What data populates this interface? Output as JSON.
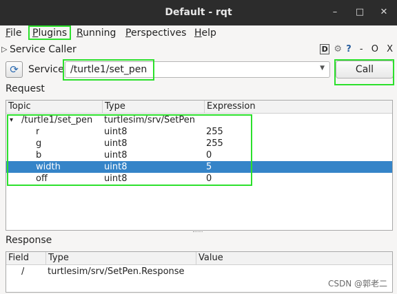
{
  "window": {
    "title": "Default - rqt",
    "controls": [
      "–",
      "□",
      "✕"
    ]
  },
  "menubar": {
    "items": [
      {
        "accel": "F",
        "rest": "ile"
      },
      {
        "accel": "P",
        "rest": "lugins"
      },
      {
        "accel": "R",
        "rest": "unning"
      },
      {
        "accel": "P",
        "rest": "erspectives"
      },
      {
        "accel": "H",
        "rest": "elp"
      }
    ]
  },
  "plugin": {
    "title": "Service Caller",
    "header_icons": [
      "D",
      "⚙",
      "?",
      "-",
      "O",
      "X"
    ]
  },
  "service": {
    "label": "Service",
    "value": "/turtle1/set_pen",
    "call_label": "Call",
    "refresh_icon": "refresh-icon"
  },
  "request": {
    "label": "Request",
    "columns": [
      "Topic",
      "Type",
      "Expression"
    ],
    "rows": [
      {
        "topic": "/turtle1/set_pen",
        "type": "turtlesim/srv/SetPen",
        "expr": "",
        "expander": "▾",
        "selected": false
      },
      {
        "topic": "r",
        "type": "uint8",
        "expr": "255",
        "selected": false
      },
      {
        "topic": "g",
        "type": "uint8",
        "expr": "255",
        "selected": false
      },
      {
        "topic": "b",
        "type": "uint8",
        "expr": "0",
        "selected": false
      },
      {
        "topic": "width",
        "type": "uint8",
        "expr": "5",
        "selected": true
      },
      {
        "topic": "off",
        "type": "uint8",
        "expr": "0",
        "selected": false
      }
    ]
  },
  "response": {
    "label": "Response",
    "columns": [
      "Field",
      "Type",
      "Value"
    ],
    "rows": [
      {
        "field": "/",
        "type": "turtlesim/srv/SetPen.Response",
        "value": ""
      }
    ]
  },
  "watermark": "CSDN @郭老二",
  "colors": {
    "highlight": "#2be02b",
    "selection": "#3584c8",
    "titlebar": "#2c2c2c"
  }
}
